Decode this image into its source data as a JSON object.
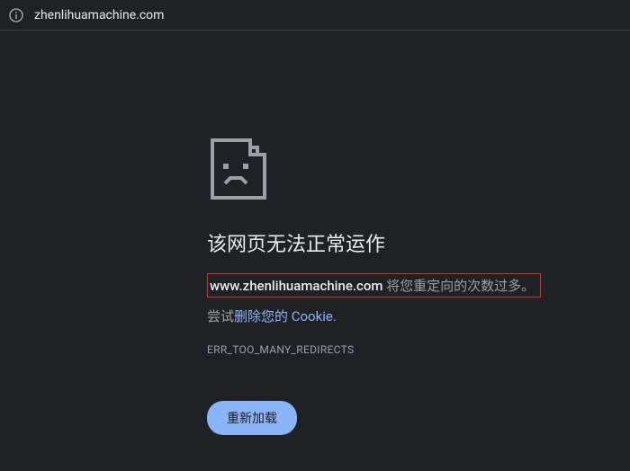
{
  "address_bar": {
    "url": "zhenlihuamachine.com"
  },
  "error": {
    "heading": "该网页无法正常运作",
    "domain": "www.zhenlihuamachine.com",
    "message": " 将您重定向的次数过多。",
    "suggestion_prefix": "尝试",
    "suggestion_link": "删除您的 Cookie",
    "suggestion_suffix": ".",
    "code": "ERR_TOO_MANY_REDIRECTS",
    "reload_button": "重新加载"
  }
}
